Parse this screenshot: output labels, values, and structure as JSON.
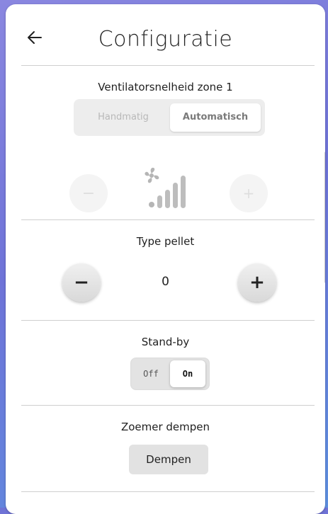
{
  "header": {
    "title": "Configuratie",
    "back_icon": "arrow-left-icon"
  },
  "fan_zone1": {
    "label": "Ventilatorsnelheid zone 1",
    "modes": [
      "Handmatig",
      "Automatisch"
    ],
    "selected_mode": "Automatisch",
    "minus_symbol": "−",
    "plus_symbol": "+",
    "icon": "fan-speed-icon",
    "speed_level_count": 4
  },
  "pellet": {
    "label": "Type pellet",
    "value": "0",
    "minus_symbol": "−",
    "plus_symbol": "+"
  },
  "standby": {
    "label": "Stand-by",
    "off_label": "Off",
    "on_label": "On",
    "selected": "On"
  },
  "buzzer": {
    "label": "Zoemer dempen",
    "button_label": "Dempen"
  },
  "colors": {
    "accent_bg": "#6f73d6",
    "card_bg": "#ffffff",
    "disabled_text": "#b8b8b8"
  }
}
